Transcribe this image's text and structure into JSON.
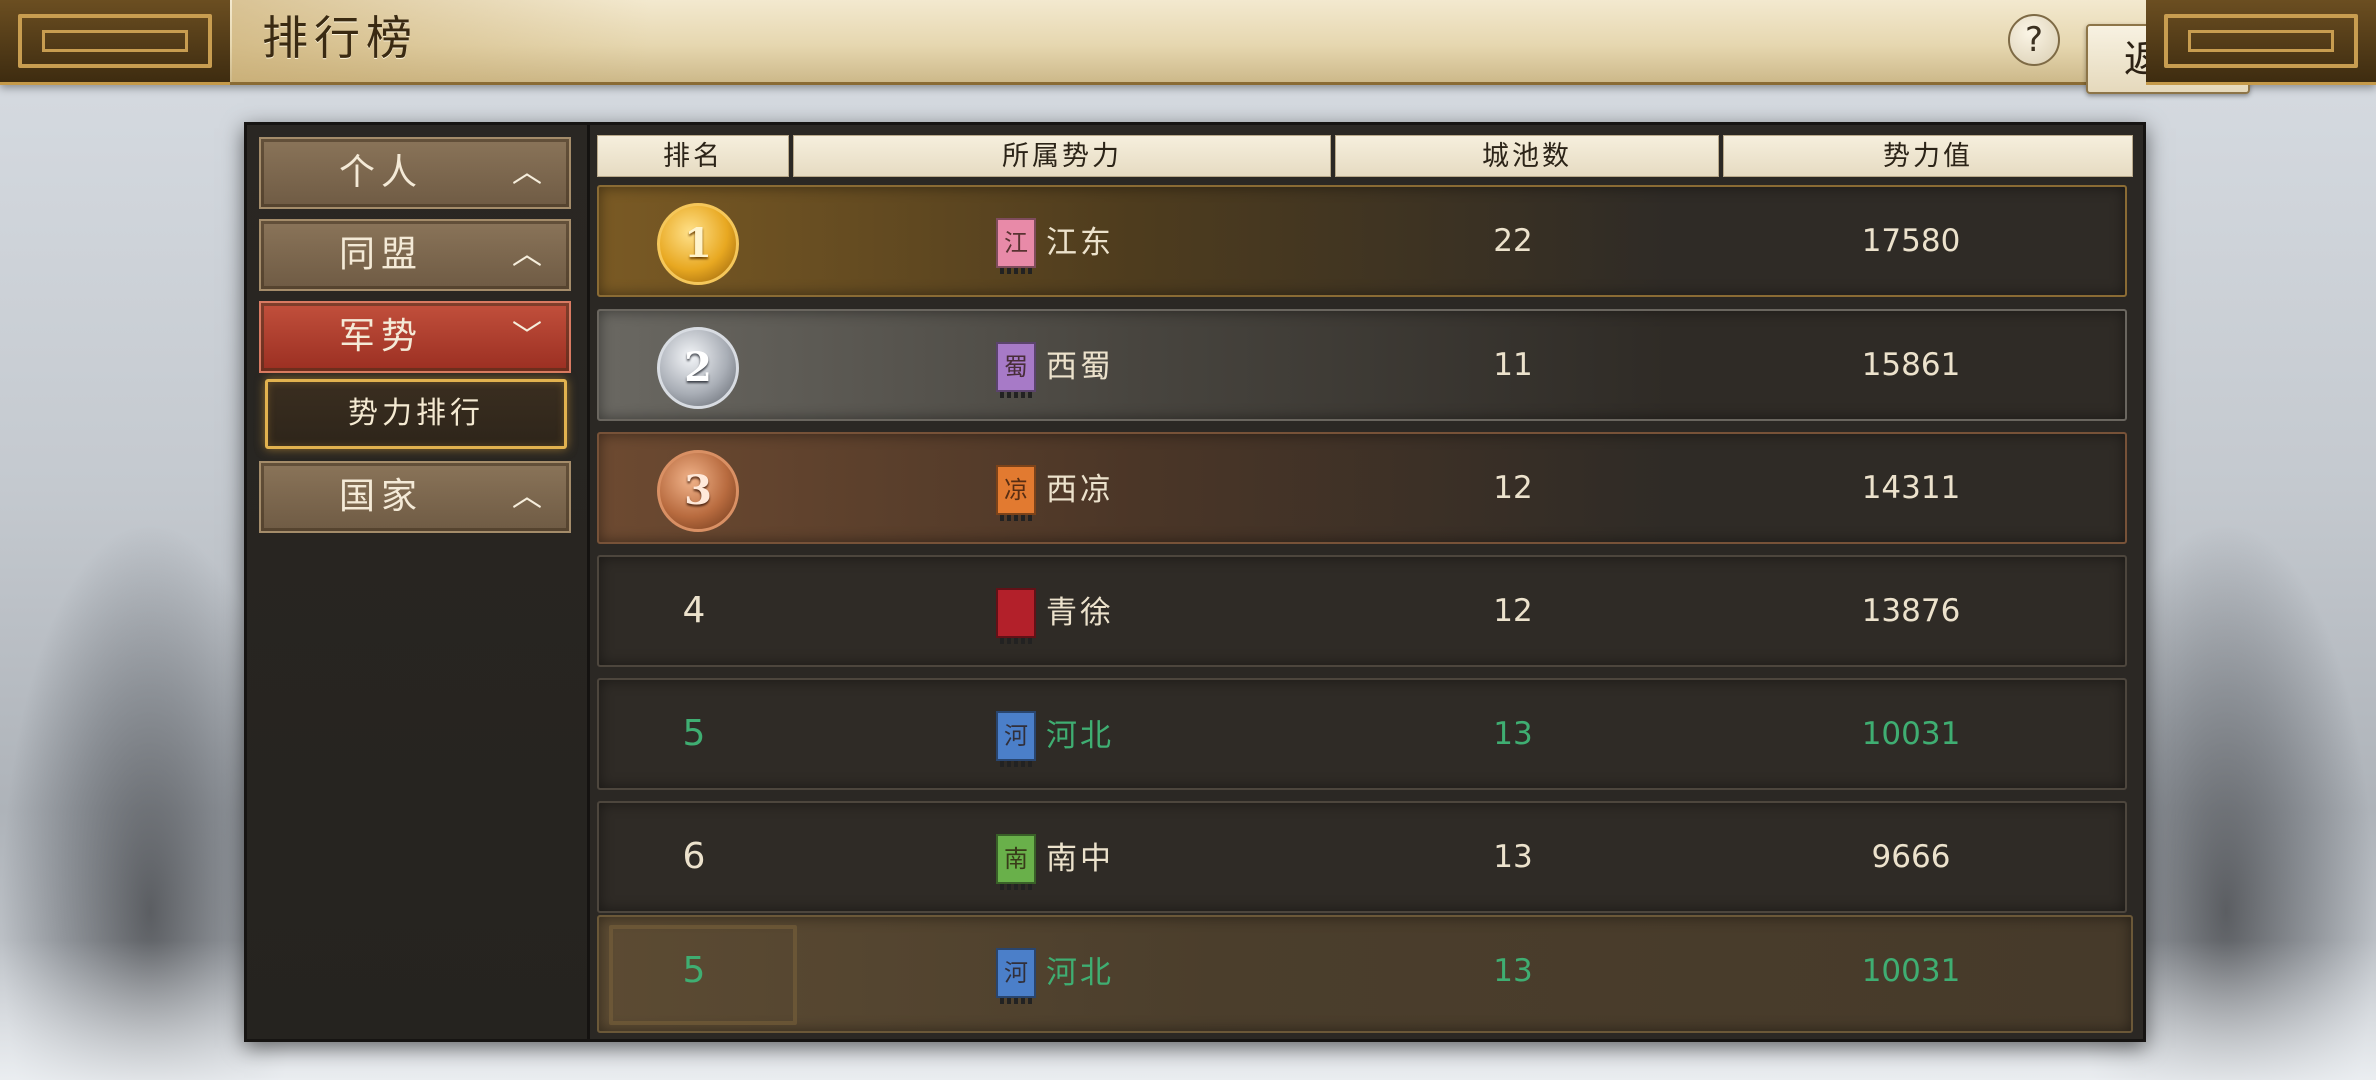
{
  "header": {
    "title": "排行榜",
    "help_label": "?",
    "back_label": "返回"
  },
  "sidebar": {
    "items": [
      {
        "label": "个人",
        "chevron": "︿"
      },
      {
        "label": "同盟",
        "chevron": "︿"
      },
      {
        "label": "军势",
        "chevron": "﹀"
      },
      {
        "label": "国家",
        "chevron": "︿"
      }
    ],
    "sub_item": {
      "label": "势力排行"
    }
  },
  "table": {
    "headers": [
      "排名",
      "所属势力",
      "城池数",
      "势力值"
    ],
    "rows": [
      {
        "rank": "1",
        "flag_char": "江",
        "flag_color": "#e88aa8",
        "faction": "江东",
        "cities": "22",
        "power": "17580"
      },
      {
        "rank": "2",
        "flag_char": "蜀",
        "flag_color": "#a77ac7",
        "faction": "西蜀",
        "cities": "11",
        "power": "15861"
      },
      {
        "rank": "3",
        "flag_char": "凉",
        "flag_color": "#e27a30",
        "faction": "西凉",
        "cities": "12",
        "power": "14311"
      },
      {
        "rank": "4",
        "flag_char": "",
        "flag_color": "#b3202a",
        "faction": "青徐",
        "cities": "12",
        "power": "13876"
      },
      {
        "rank": "5",
        "flag_char": "河",
        "flag_color": "#4b7fc9",
        "faction": "河北",
        "cities": "13",
        "power": "10031"
      },
      {
        "rank": "6",
        "flag_char": "南",
        "flag_color": "#69b04a",
        "faction": "南中",
        "cities": "13",
        "power": "9666"
      }
    ],
    "self_row": {
      "rank": "5",
      "flag_char": "河",
      "flag_color": "#4b7fc9",
      "faction": "河北",
      "cities": "13",
      "power": "10031"
    }
  },
  "colors": {
    "highlight_text": "#3fae72",
    "accent_red": "#b33a28",
    "gold_border": "#e2b24f"
  }
}
